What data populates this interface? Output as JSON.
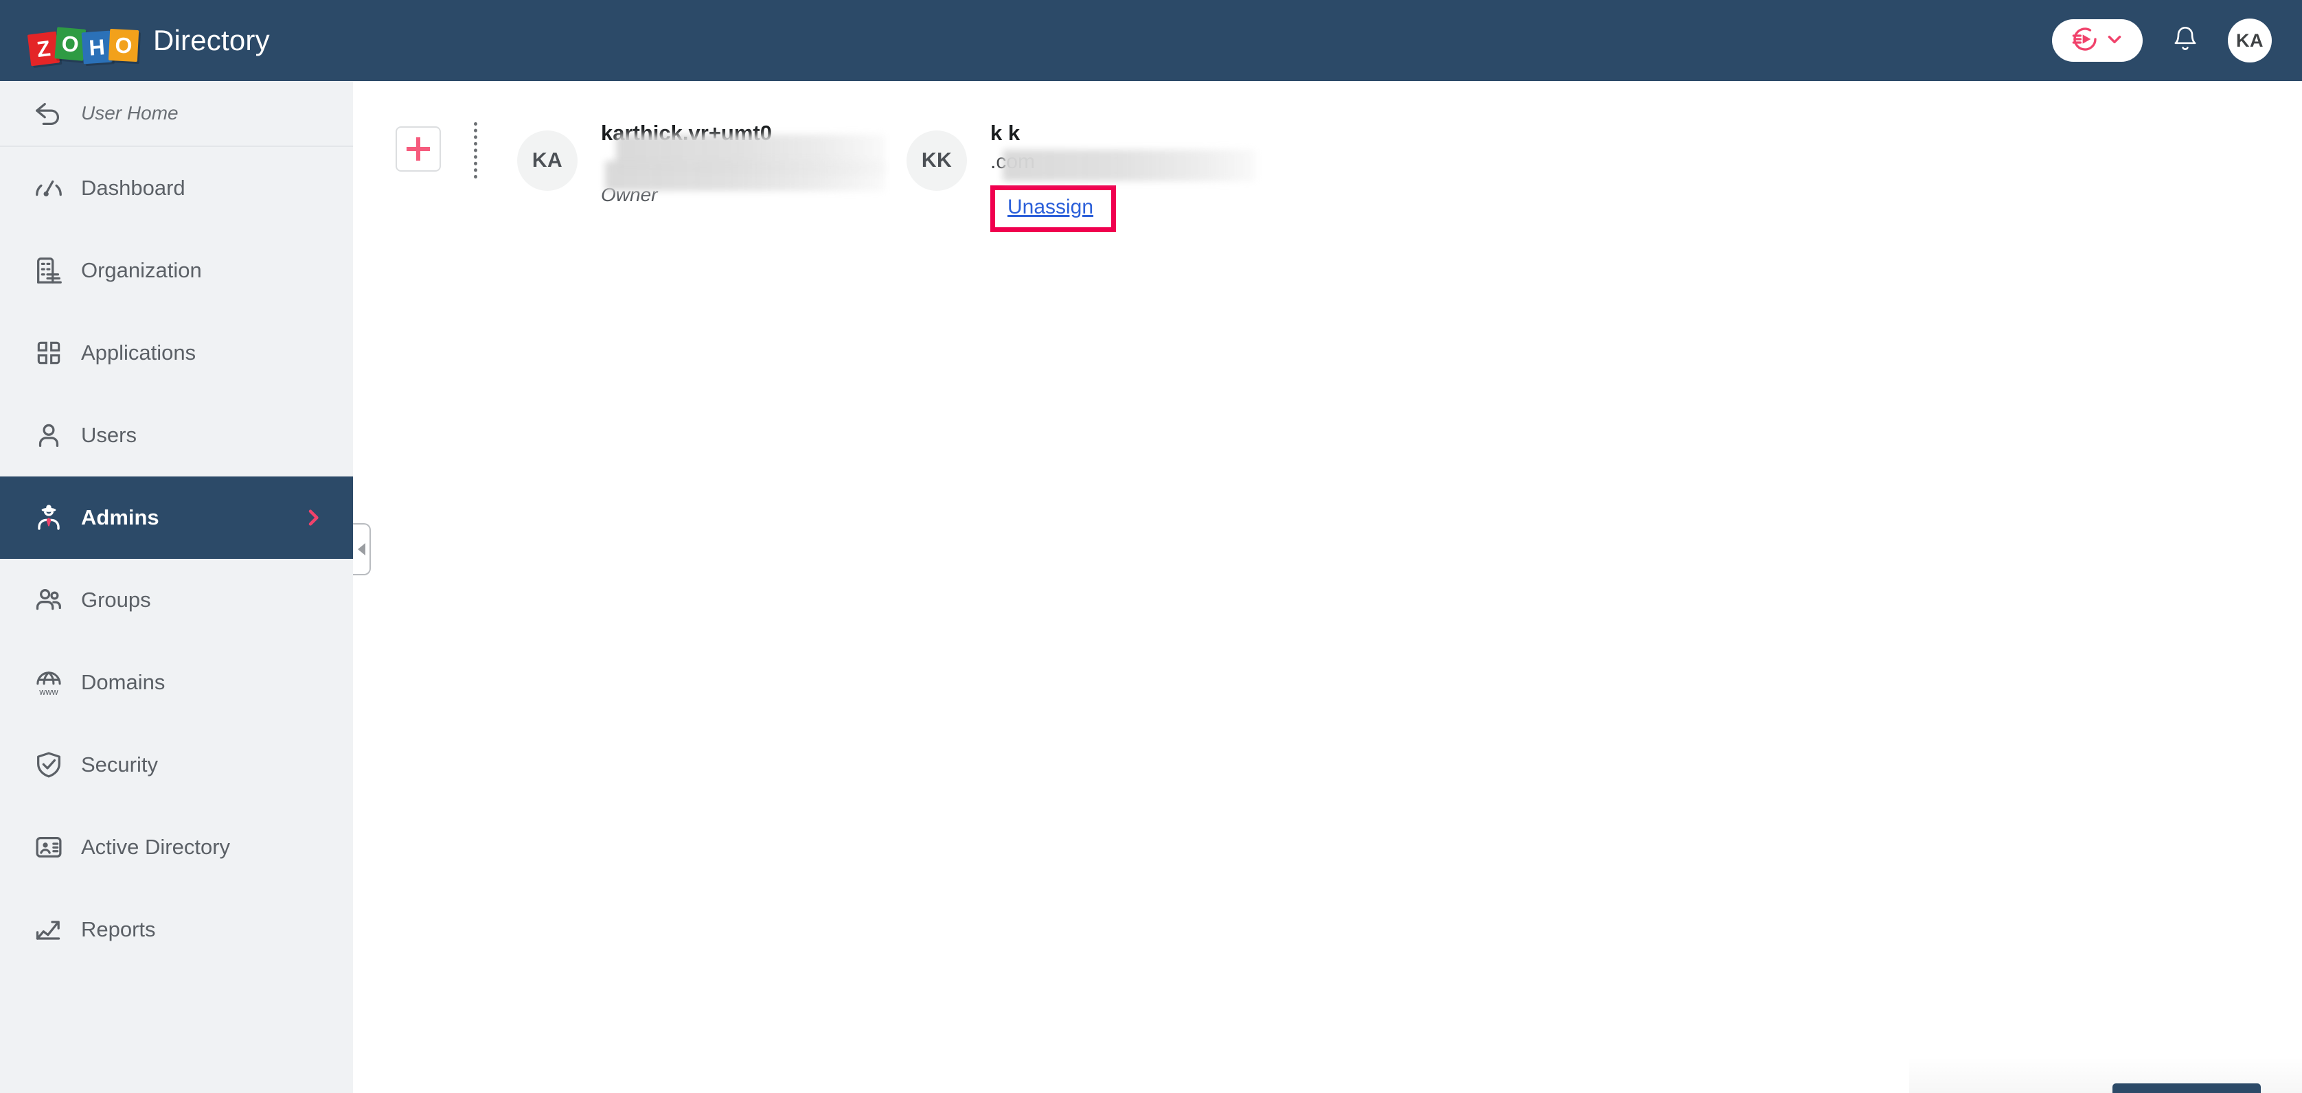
{
  "header": {
    "brand_letters": [
      "Z",
      "O",
      "H",
      "O"
    ],
    "brand_colors": [
      "#e42527",
      "#2e9b43",
      "#2b71b8",
      "#f2a11b"
    ],
    "product_title": "Directory",
    "quick_launch_icon": "quick-launch-icon",
    "chevron_icon": "chevron-down-icon",
    "notification_icon": "bell-icon",
    "user_avatar_initials": "KA",
    "background": "#2c4a68"
  },
  "sidebar": {
    "background": "#f0f2f4",
    "active_background": "#2c4a68",
    "active_accent": "#f0426b",
    "collapse_handle": "collapse-sidebar-handle",
    "items": [
      {
        "label": "User Home",
        "icon": "back-arrow-icon",
        "active": false,
        "italic": true
      },
      {
        "label": "Dashboard",
        "icon": "gauge-icon",
        "active": false
      },
      {
        "label": "Organization",
        "icon": "building-icon",
        "active": false
      },
      {
        "label": "Applications",
        "icon": "apps-grid-icon",
        "active": false
      },
      {
        "label": "Users",
        "icon": "user-icon",
        "active": false
      },
      {
        "label": "Admins",
        "icon": "admin-person-icon",
        "active": true,
        "chevron": "chevron-right-icon"
      },
      {
        "label": "Groups",
        "icon": "users-group-icon",
        "active": false
      },
      {
        "label": "Domains",
        "icon": "globe-www-icon",
        "active": false
      },
      {
        "label": "Security",
        "icon": "shield-check-icon",
        "active": false
      },
      {
        "label": "Active Directory",
        "icon": "contact-card-icon",
        "active": false
      },
      {
        "label": "Reports",
        "icon": "chart-arrow-icon",
        "active": false
      }
    ]
  },
  "main": {
    "add_admin_button": {
      "name": "add-admin-button",
      "icon": "plus-icon",
      "color": "#f65b7d"
    },
    "admins": [
      {
        "initials": "KA",
        "name": "karthick.vr+umt0",
        "email": "",
        "role": "Owner",
        "email_redacted": true,
        "name_redacted": true,
        "action": null
      },
      {
        "initials": "KK",
        "name": "k k",
        "email": ".com",
        "role": "",
        "email_redacted": true,
        "name_redacted": false,
        "action": "Unassign"
      }
    ],
    "highlight": {
      "target": "Unassign",
      "border_color": "#f0004f",
      "link_color": "#2b5fd9"
    }
  }
}
